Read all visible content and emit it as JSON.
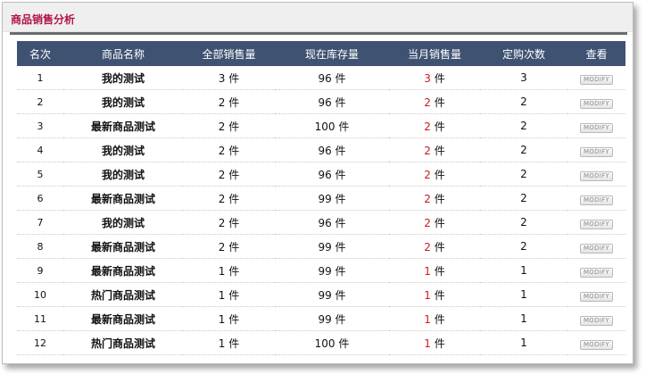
{
  "title": "商品销售分析",
  "columns": [
    "名次",
    "商品名称",
    "全部销售量",
    "现在库存量",
    "当月销售量",
    "定购次数",
    "查看"
  ],
  "unit": "件",
  "colors": {
    "title": "#b0134b",
    "header_bg": "#3f5272",
    "product_name": "#4b1a8f",
    "month_sales": "#d01818"
  },
  "rows": [
    {
      "rank": "1",
      "name": "我的测试",
      "total": "3",
      "stock": "96",
      "month": "3",
      "orders": "3",
      "action": "MODIFY"
    },
    {
      "rank": "2",
      "name": "我的测试",
      "total": "2",
      "stock": "96",
      "month": "2",
      "orders": "2",
      "action": "MODIFY"
    },
    {
      "rank": "3",
      "name": "最新商品测试",
      "total": "2",
      "stock": "100",
      "month": "2",
      "orders": "2",
      "action": "MODIFY"
    },
    {
      "rank": "4",
      "name": "我的测试",
      "total": "2",
      "stock": "96",
      "month": "2",
      "orders": "2",
      "action": "MODIFY"
    },
    {
      "rank": "5",
      "name": "我的测试",
      "total": "2",
      "stock": "96",
      "month": "2",
      "orders": "2",
      "action": "MODIFY"
    },
    {
      "rank": "6",
      "name": "最新商品测试",
      "total": "2",
      "stock": "99",
      "month": "2",
      "orders": "2",
      "action": "MODIFY"
    },
    {
      "rank": "7",
      "name": "我的测试",
      "total": "2",
      "stock": "96",
      "month": "2",
      "orders": "2",
      "action": "MODIFY"
    },
    {
      "rank": "8",
      "name": "最新商品测试",
      "total": "2",
      "stock": "99",
      "month": "2",
      "orders": "2",
      "action": "MODIFY"
    },
    {
      "rank": "9",
      "name": "最新商品测试",
      "total": "1",
      "stock": "99",
      "month": "1",
      "orders": "1",
      "action": "MODIFY"
    },
    {
      "rank": "10",
      "name": "热门商品测试",
      "total": "1",
      "stock": "99",
      "month": "1",
      "orders": "1",
      "action": "MODIFY"
    },
    {
      "rank": "11",
      "name": "最新商品测试",
      "total": "1",
      "stock": "99",
      "month": "1",
      "orders": "1",
      "action": "MODIFY"
    },
    {
      "rank": "12",
      "name": "热门商品测试",
      "total": "1",
      "stock": "100",
      "month": "1",
      "orders": "1",
      "action": "MODIFY"
    }
  ]
}
